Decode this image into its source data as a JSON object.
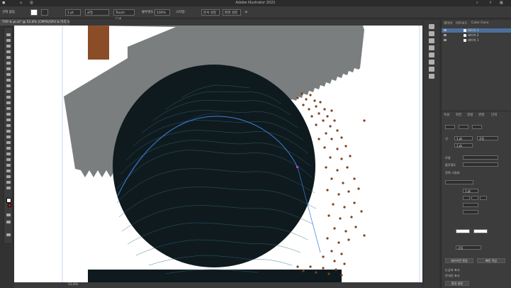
{
  "app": {
    "title": "Adobe Illustrator 2021"
  },
  "document": {
    "tab_label": "TOP & pr.ai* @ 52.8% (CMYK/GPU & 미리 보기)",
    "zoom_status": "52.8%"
  },
  "control_bar": {
    "stroke_weight": "1 pt",
    "stroke_style": "균등",
    "brush": "Touch Call...",
    "opacity_label": "불투명도:",
    "opacity_value": "100%",
    "style_label": "스타일:",
    "doc_setup": "문서 설정",
    "prefs": "환경 설정"
  },
  "layers_panel": {
    "tabs": [
      "레이어",
      "아트보드",
      "Color Conv"
    ],
    "layers": [
      {
        "name": "레이어 3",
        "selected": true
      },
      {
        "name": "레이어 2",
        "selected": false
      },
      {
        "name": "레이어 1",
        "selected": false
      }
    ]
  },
  "properties_panel": {
    "tabs": [
      "속성",
      "회전",
      "정렬",
      "변형",
      "단락"
    ],
    "stroke_label": "선",
    "stroke_value": "1 pt",
    "stroke_type": "균등",
    "appearance_label": "모양",
    "opacity_label": "불투명도",
    "checkbox_label": "전역 그림자",
    "buttons": [
      "레이아웃 편집",
      "빠른 작업"
    ],
    "bottom_checks": [
      "눈금자 표시",
      "안내선 표시"
    ],
    "bottom_button": "환경 설정"
  },
  "colors": {
    "ui_dark": "#323232",
    "canvas_bg": "#ffffff",
    "saw_gray": "#7a7e7e",
    "brown": "#8b4d27",
    "circle_fill": "#0f1a1f",
    "ring_line": "#2f6a7a",
    "blue_path": "#3b7fd6",
    "dot_brown": "#7b3f1c"
  },
  "icons": [
    "home-icon",
    "layout-icon",
    "eye-icon",
    "lock-icon",
    "search-icon",
    "share-icon"
  ]
}
